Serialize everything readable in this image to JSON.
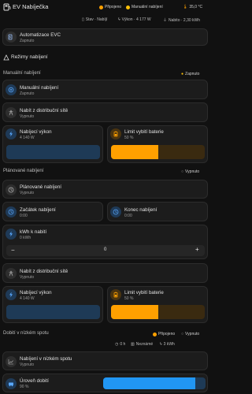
{
  "header": {
    "title": "EV Nabíječka",
    "status_connected": "Připojeno",
    "status_manual": "Manuální nabíjení",
    "temperature": "35,0 °C",
    "stat_state": "Stav · Nabíjí",
    "stat_power": "Výkon · 4 177 W",
    "stat_charged": "Nabito · 2,30 kWh"
  },
  "automation": {
    "title": "Automatizace EVC",
    "state": "Zapnuto"
  },
  "modes_heading": "Režimy nabíjení",
  "manual": {
    "heading": "Manuální nabíjení",
    "badge": "Zapnuto",
    "card_title": "Manuální nabíjení",
    "card_state": "Zapnuto",
    "grid_title": "Nabít z distribuční sítě",
    "grid_state": "Vypnuto",
    "power_title": "Nabíjecí výkon",
    "power_value": "4 140 W",
    "limit_title": "Limit vybití baterie",
    "limit_value": "50 %",
    "limit_fraction": 0.5
  },
  "planned": {
    "heading": "Plánované nabíjení",
    "badge": "Vypnuto",
    "card_title": "Plánované nabíjení",
    "card_state": "Vypnuto",
    "start_title": "Začátek nabíjení",
    "start_value": "0:00",
    "end_title": "Konec nabíjení",
    "end_value": "0:00",
    "kwh_title": "kWh k nabití",
    "kwh_value": "0 kWh",
    "stepper_value": "0",
    "stepper_minus": "−",
    "stepper_plus": "+",
    "grid_title": "Nabít z distribuční sítě",
    "grid_state": "Vypnuto",
    "power_title": "Nabíjecí výkon",
    "power_value": "4 140 W",
    "limit_title": "Limit vybití baterie",
    "limit_value": "50 %",
    "limit_fraction": 0.5
  },
  "spot": {
    "heading": "Dobití v nízkém spotu",
    "badge_connected": "Připojeno",
    "badge_state": "Vypnuto",
    "stat_hours": "0 h",
    "stat_unknown": "Neznámé",
    "stat_kwh": "3 kWh",
    "card_title": "Nabíjení v nízkém spotu",
    "card_state": "Vypnuto",
    "level_title": "Úroveň dobití",
    "level_value": "90 %",
    "level_fraction": 0.9
  },
  "colors": {
    "blue": "#2196f3",
    "blue_dark": "#1e3a56",
    "orange": "#ffa000",
    "orange_track": "#3a2a10",
    "green": "#4caf50",
    "accent_yellow": "#ffc107"
  }
}
